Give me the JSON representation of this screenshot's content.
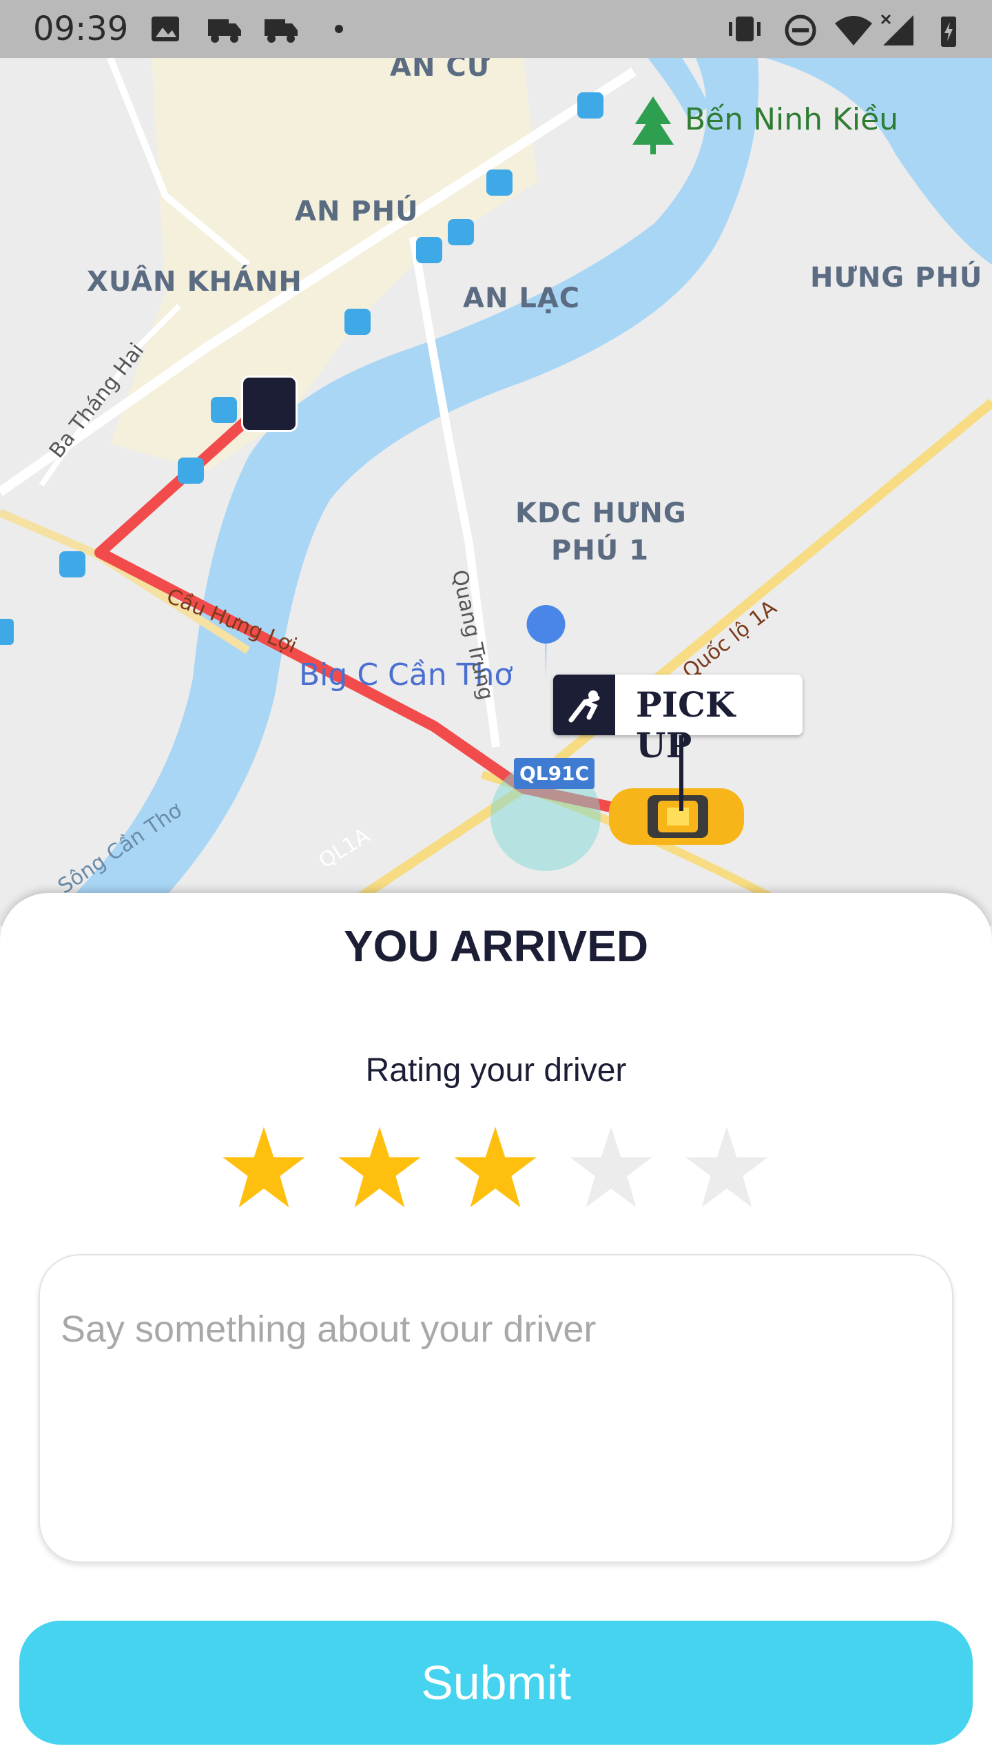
{
  "status_bar": {
    "time": "09:39",
    "icons": [
      "image-icon",
      "truck-icon",
      "truck-icon",
      "dot-icon",
      "vibrate-icon",
      "do-not-disturb-icon",
      "wifi-icon",
      "signal-icon",
      "battery-charging-icon"
    ]
  },
  "map": {
    "areas": [
      "AN CƯ",
      "AN PHÚ",
      "XUÂN KHÁNH",
      "AN LẠC",
      "HƯNG PHÚ",
      "KDC HƯNG",
      "PHÚ 1"
    ],
    "poi": "Bến Ninh Kiều",
    "shop": "Big C Cần Thơ",
    "roads": [
      "Ba Tháng Hai",
      "Quang Trung",
      "Cầu Hưng Lợi",
      "Đ. Quốc lộ 1A",
      "QL1A",
      "Sông Cần Thơ"
    ],
    "highway_badge": "QL91C",
    "pickup_label": "PICK UP",
    "route_color": "#f24b4b",
    "river_color": "#a9d6f5"
  },
  "sheet": {
    "title": "YOU ARRIVED",
    "rating_label": "Rating your driver",
    "rating": 3,
    "max_rating": 5,
    "star_active_color": "#ffbf0f",
    "star_inactive_color": "#ececec",
    "comment_placeholder": "Say something about your driver",
    "comment_value": "",
    "submit_label": "Submit"
  }
}
